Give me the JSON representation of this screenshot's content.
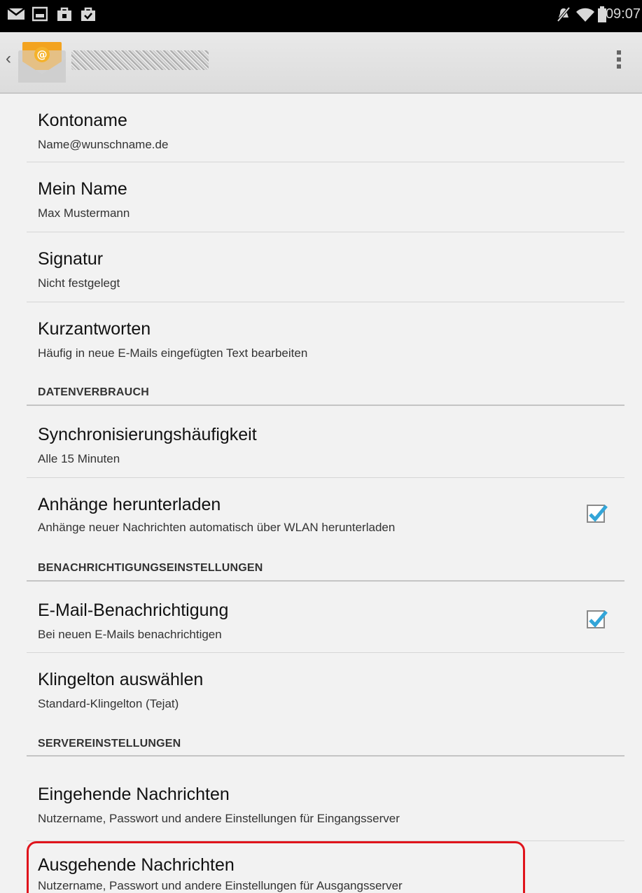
{
  "status_bar": {
    "time": "09:07",
    "left_icons": [
      "mail-icon",
      "gallery-icon",
      "bag-icon",
      "bag-check-icon"
    ],
    "right_icons": [
      "mute-icon",
      "wifi-icon",
      "battery-icon"
    ]
  },
  "action_bar": {
    "app_icon": "email-app-icon",
    "account_title_blurred": true
  },
  "settings": {
    "account_name": {
      "title": "Kontoname",
      "summary": "Name@wunschname.de"
    },
    "my_name": {
      "title": "Mein Name",
      "summary": "Max Mustermann"
    },
    "signature": {
      "title": "Signatur",
      "summary": "Nicht festgelegt"
    },
    "quick_responses": {
      "title": "Kurzantworten",
      "summary": "Häufig in neue E-Mails eingefügten Text bearbeiten"
    },
    "data_usage_header": "DATENVERBRAUCH",
    "sync_frequency": {
      "title": "Synchronisierungshäufigkeit",
      "summary": "Alle 15 Minuten"
    },
    "download_attachments": {
      "title": "Anhänge herunterladen",
      "summary": "Anhänge neuer Nachrichten automatisch über WLAN herunterladen",
      "checked": true
    },
    "notifications_header": "BENACHRICHTIGUNGSEINSTELLUNGEN",
    "email_notification": {
      "title": "E-Mail-Benachrichtigung",
      "summary": "Bei neuen E-Mails benachrichtigen",
      "checked": true
    },
    "ringtone": {
      "title": "Klingelton auswählen",
      "summary": "Standard-Klingelton (Tejat)"
    },
    "server_header": "SERVEREINSTELLUNGEN",
    "incoming": {
      "title": "Eingehende Nachrichten",
      "summary": "Nutzername, Passwort und andere Einstellungen für Eingangsserver"
    },
    "outgoing": {
      "title": "Ausgehende Nachrichten",
      "summary": "Nutzername, Passwort und andere Einstellungen für Ausgangsserver"
    }
  },
  "colors": {
    "accent_check": "#33a5d8",
    "highlight_ring": "#e0141c",
    "status_bar": "#000000"
  }
}
